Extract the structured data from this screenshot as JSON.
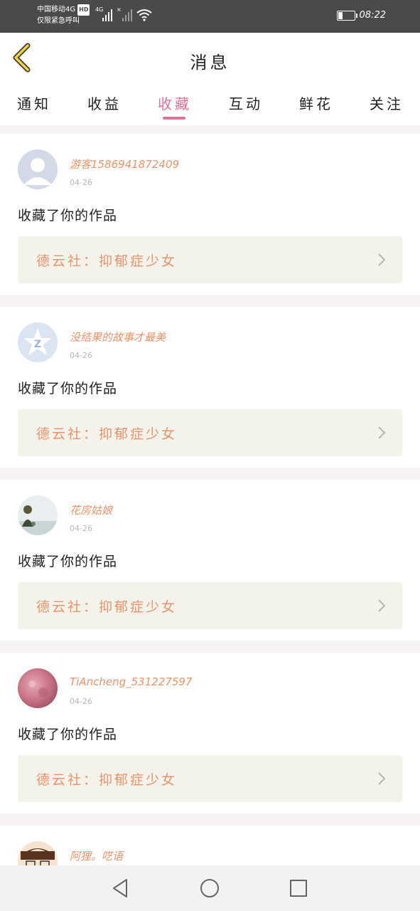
{
  "status_bar": {
    "carrier": "中国移动4G",
    "hd": "HD",
    "emergency": "仅限紧急呼叫",
    "net_1": "4G",
    "time": "08:22",
    "battery_percent": 20
  },
  "header": {
    "title": "消息"
  },
  "tabs": [
    {
      "label": "通知",
      "active": false
    },
    {
      "label": "收益",
      "active": false
    },
    {
      "label": "收藏",
      "active": true
    },
    {
      "label": "互动",
      "active": false
    },
    {
      "label": "鲜花",
      "active": false
    },
    {
      "label": "关注",
      "active": false
    }
  ],
  "messages": [
    {
      "user": "游客1586941872409",
      "date": "04-26",
      "action": "收藏了你的作品",
      "work": "德云社：抑郁症少女",
      "avatar": "default-person-avatar"
    },
    {
      "user": "没结果的故事才最美",
      "date": "04-26",
      "action": "收藏了你的作品",
      "work": "德云社：抑郁症少女",
      "avatar": "qzone-star-avatar"
    },
    {
      "user": "花房姑娘",
      "date": "04-26",
      "action": "收藏了你的作品",
      "work": "德云社：抑郁症少女",
      "avatar": "girl-photo-avatar"
    },
    {
      "user": "TiAncheng_531227597",
      "date": "04-26",
      "action": "收藏了你的作品",
      "work": "德云社：抑郁症少女",
      "avatar": "pink-texture-avatar"
    },
    {
      "user": "阿狸。呓语",
      "date": "",
      "action": "",
      "work": "",
      "avatar": "cartoon-avatar"
    }
  ],
  "colors": {
    "accent_pink": "#e0719a",
    "username_orange": "#e8936b",
    "work_bg": "#f3f3ec"
  },
  "navbar": {
    "icons": [
      "back-triangle-icon",
      "home-circle-icon",
      "recents-square-icon"
    ]
  }
}
